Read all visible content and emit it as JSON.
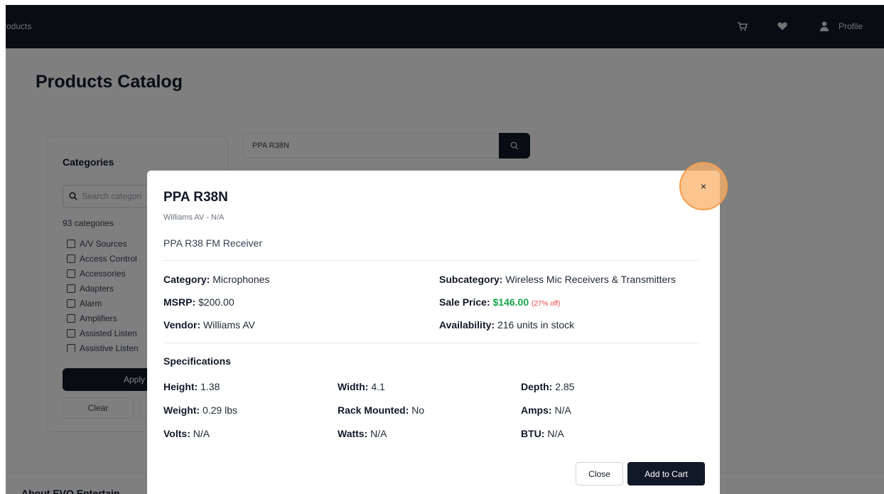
{
  "nav": {
    "brand": "roducts",
    "profile_label": "Profile",
    "icons": [
      "cart-icon",
      "heart-icon",
      "user-icon"
    ]
  },
  "page": {
    "title": "Products Catalog",
    "categories": {
      "title": "Categories",
      "search_placeholder": "Search categori",
      "count": "93 categories",
      "items": [
        "A/V Sources",
        "Access Control",
        "Accessories",
        "Adapters",
        "Alarm",
        "Amplifiers",
        "Assisted Listen",
        "Assistive Listen"
      ],
      "apply_label": "Apply Filte",
      "clear_label": "Clear"
    },
    "search": {
      "value": "PPA R38N"
    },
    "footer_text": "About EVO Entertain"
  },
  "modal": {
    "title": "PPA R38N",
    "subtitle": "Williams AV - N/A",
    "description": "PPA R38 FM Receiver",
    "close_x": "×",
    "details": {
      "category_label": "Category:",
      "category_value": "Microphones",
      "subcategory_label": "Subcategory:",
      "subcategory_value": "Wireless Mic Receivers & Transmitters",
      "msrp_label": "MSRP:",
      "msrp_value": "$200.00",
      "sale_label": "Sale Price:",
      "sale_value": "$146.00",
      "sale_discount": "(27% off)",
      "vendor_label": "Vendor:",
      "vendor_value": "Williams AV",
      "availability_label": "Availability:",
      "availability_value": "216 units in stock"
    },
    "specs_title": "Specifications",
    "specs": [
      {
        "label": "Height:",
        "value": "1.38"
      },
      {
        "label": "Width:",
        "value": "4.1"
      },
      {
        "label": "Depth:",
        "value": "2.85"
      },
      {
        "label": "Weight:",
        "value": "0.29 lbs"
      },
      {
        "label": "Rack Mounted:",
        "value": "No"
      },
      {
        "label": "Amps:",
        "value": "N/A"
      },
      {
        "label": "Volts:",
        "value": "N/A"
      },
      {
        "label": "Watts:",
        "value": "N/A"
      },
      {
        "label": "BTU:",
        "value": "N/A"
      }
    ],
    "close_label": "Close",
    "add_to_cart_label": "Add to Cart"
  },
  "colors": {
    "nav_bg": "#111827",
    "sale_green": "#16a34a",
    "discount_red": "#ef4444",
    "highlight_orange": "#f59e4a"
  }
}
